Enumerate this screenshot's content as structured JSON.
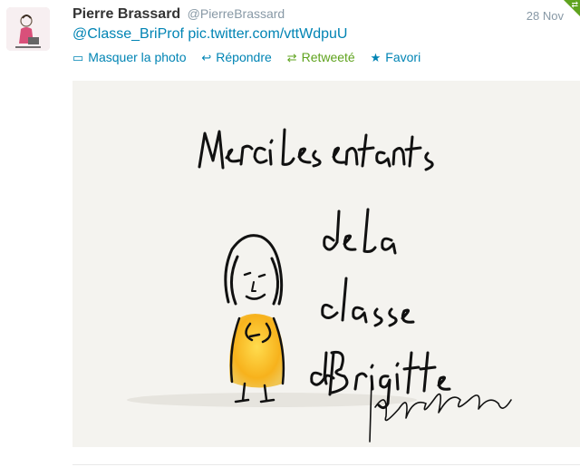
{
  "tweet": {
    "fullname": "Pierre Brassard",
    "username": "@PierreBrassard",
    "time": "28 Nov",
    "mention": "@Classe_BriProf",
    "link": "pic.twitter.com/vttWdpuU"
  },
  "actions": {
    "hide_photo": "Masquer la photo",
    "reply": "Répondre",
    "retweeted": "Retweeté",
    "favorite": "Favori"
  },
  "photo": {
    "handwritten_text": "Merci les enfants de la classe de Brigitte Isabel Pinard"
  },
  "colors": {
    "link": "#0084b4",
    "retweet_green": "#5fa31e",
    "meta_gray": "#8899a6",
    "name": "#333333"
  },
  "icons": [
    "photo-icon",
    "reply-icon",
    "retweet-icon",
    "favorite-icon",
    "retweeted-corner-icon"
  ]
}
